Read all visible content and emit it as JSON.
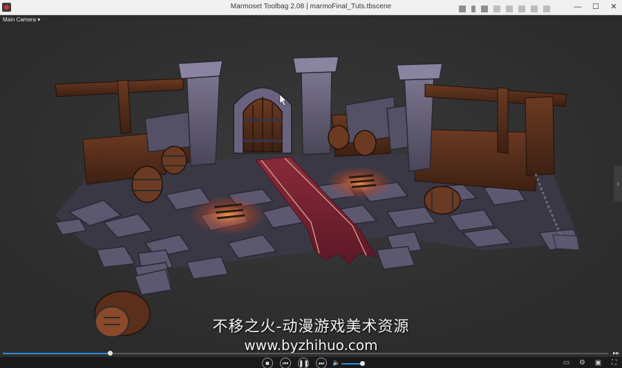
{
  "window": {
    "title": "Marmoset Toolbag 2.08  |  marmoFinal_Tuts.tbscene",
    "controls": {
      "minimize": "—",
      "maximize": "☐",
      "close": "✕"
    }
  },
  "mini_player": {
    "icons": [
      "skip-back-icon",
      "pause-icon",
      "skip-forward-icon",
      "audio-icon",
      "heart-icon",
      "pin-icon",
      "copy-icon",
      "lock-icon"
    ]
  },
  "viewport": {
    "camera_label": "Main Camera ▾",
    "side_handle_icon": "›"
  },
  "watermark": {
    "line1": "不移之火-动漫游戏美术资源",
    "line2": "www.byzhihuo.com"
  },
  "player": {
    "seek_progress": 0.177,
    "volume_level": 0.88,
    "stop_icon": "■",
    "prev_icon": "⏮",
    "pause_icon": "❚❚",
    "next_icon": "⏭",
    "volume_icon": "🔈",
    "seek_end_icon": "▸▸",
    "right_icons": [
      "▭",
      "⚙",
      "▣",
      "⛶"
    ],
    "accent_color": "#2a8fe0"
  }
}
